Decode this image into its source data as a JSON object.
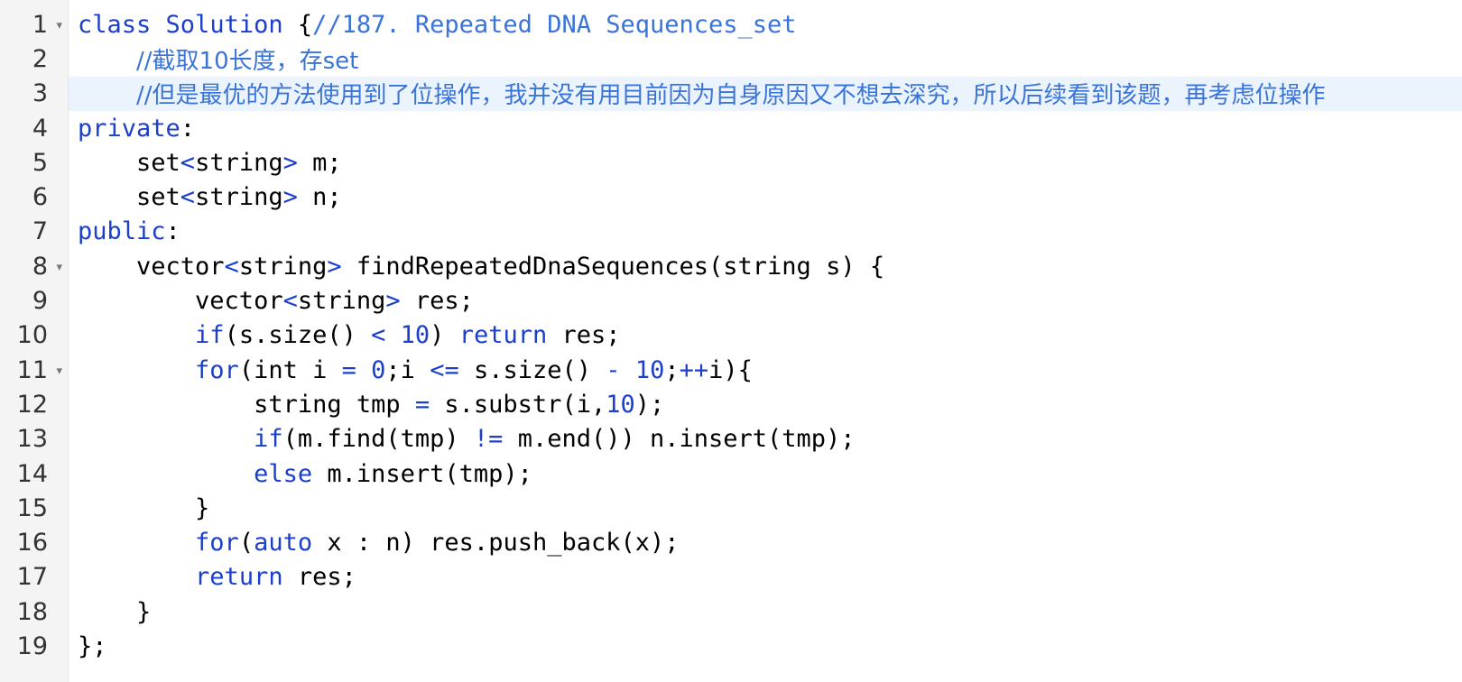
{
  "editor": {
    "active_line": 3,
    "colors": {
      "keyword": "#1b3fcc",
      "comment": "#3a74d8",
      "plain": "#000000",
      "gutter_bg": "#f4f4f4",
      "active_line_bg": "#ebf3fd"
    },
    "fold_icon": "chevron-down-icon",
    "lines": [
      {
        "number": "1",
        "fold": true,
        "tokens": [
          {
            "t": "kw",
            "v": "class"
          },
          {
            "t": "pl",
            "v": " "
          },
          {
            "t": "kw",
            "v": "Solution"
          },
          {
            "t": "pl",
            "v": " {"
          },
          {
            "t": "cm",
            "v": "//187. Repeated DNA Sequences_set"
          }
        ]
      },
      {
        "number": "2",
        "fold": false,
        "tokens": [
          {
            "t": "pl",
            "v": "    "
          },
          {
            "t": "cm",
            "v": "//截取10长度，存set"
          }
        ]
      },
      {
        "number": "3",
        "fold": false,
        "tokens": [
          {
            "t": "pl",
            "v": "    "
          },
          {
            "t": "cm",
            "v": "//但是最优的方法使用到了位操作，我并没有用目前因为自身原因又不想去深究，所以后续看到该题，再考虑位操作"
          }
        ]
      },
      {
        "number": "4",
        "fold": false,
        "tokens": [
          {
            "t": "kw",
            "v": "private"
          },
          {
            "t": "pl",
            "v": ":"
          }
        ]
      },
      {
        "number": "5",
        "fold": false,
        "tokens": [
          {
            "t": "pl",
            "v": "    set"
          },
          {
            "t": "op",
            "v": "<"
          },
          {
            "t": "pl",
            "v": "string"
          },
          {
            "t": "op",
            "v": ">"
          },
          {
            "t": "pl",
            "v": " m;"
          }
        ]
      },
      {
        "number": "6",
        "fold": false,
        "tokens": [
          {
            "t": "pl",
            "v": "    set"
          },
          {
            "t": "op",
            "v": "<"
          },
          {
            "t": "pl",
            "v": "string"
          },
          {
            "t": "op",
            "v": ">"
          },
          {
            "t": "pl",
            "v": " n;"
          }
        ]
      },
      {
        "number": "7",
        "fold": false,
        "tokens": [
          {
            "t": "kw",
            "v": "public"
          },
          {
            "t": "pl",
            "v": ":"
          }
        ]
      },
      {
        "number": "8",
        "fold": true,
        "tokens": [
          {
            "t": "pl",
            "v": "    vector"
          },
          {
            "t": "op",
            "v": "<"
          },
          {
            "t": "pl",
            "v": "string"
          },
          {
            "t": "op",
            "v": ">"
          },
          {
            "t": "pl",
            "v": " findRepeatedDnaSequences(string s) {"
          }
        ]
      },
      {
        "number": "9",
        "fold": false,
        "tokens": [
          {
            "t": "pl",
            "v": "        vector"
          },
          {
            "t": "op",
            "v": "<"
          },
          {
            "t": "pl",
            "v": "string"
          },
          {
            "t": "op",
            "v": ">"
          },
          {
            "t": "pl",
            "v": " res;"
          }
        ]
      },
      {
        "number": "10",
        "fold": false,
        "tokens": [
          {
            "t": "pl",
            "v": "        "
          },
          {
            "t": "kw",
            "v": "if"
          },
          {
            "t": "pl",
            "v": "(s.size() "
          },
          {
            "t": "op",
            "v": "<"
          },
          {
            "t": "pl",
            "v": " "
          },
          {
            "t": "num",
            "v": "10"
          },
          {
            "t": "pl",
            "v": ") "
          },
          {
            "t": "kw",
            "v": "return"
          },
          {
            "t": "pl",
            "v": " res;"
          }
        ]
      },
      {
        "number": "11",
        "fold": true,
        "tokens": [
          {
            "t": "pl",
            "v": "        "
          },
          {
            "t": "kw",
            "v": "for"
          },
          {
            "t": "pl",
            "v": "(int i "
          },
          {
            "t": "op",
            "v": "="
          },
          {
            "t": "pl",
            "v": " "
          },
          {
            "t": "num",
            "v": "0"
          },
          {
            "t": "pl",
            "v": ";i "
          },
          {
            "t": "op",
            "v": "<="
          },
          {
            "t": "pl",
            "v": " s.size() "
          },
          {
            "t": "op",
            "v": "-"
          },
          {
            "t": "pl",
            "v": " "
          },
          {
            "t": "num",
            "v": "10"
          },
          {
            "t": "pl",
            "v": ";"
          },
          {
            "t": "op",
            "v": "++"
          },
          {
            "t": "pl",
            "v": "i){"
          }
        ]
      },
      {
        "number": "12",
        "fold": false,
        "tokens": [
          {
            "t": "pl",
            "v": "            string tmp "
          },
          {
            "t": "op",
            "v": "="
          },
          {
            "t": "pl",
            "v": " s.substr(i,"
          },
          {
            "t": "num",
            "v": "10"
          },
          {
            "t": "pl",
            "v": ");"
          }
        ]
      },
      {
        "number": "13",
        "fold": false,
        "tokens": [
          {
            "t": "pl",
            "v": "            "
          },
          {
            "t": "kw",
            "v": "if"
          },
          {
            "t": "pl",
            "v": "(m.find(tmp) "
          },
          {
            "t": "op",
            "v": "!="
          },
          {
            "t": "pl",
            "v": " m.end()) n.insert(tmp);"
          }
        ]
      },
      {
        "number": "14",
        "fold": false,
        "tokens": [
          {
            "t": "pl",
            "v": "            "
          },
          {
            "t": "kw",
            "v": "else"
          },
          {
            "t": "pl",
            "v": " m.insert(tmp);"
          }
        ]
      },
      {
        "number": "15",
        "fold": false,
        "tokens": [
          {
            "t": "pl",
            "v": "        }"
          }
        ]
      },
      {
        "number": "16",
        "fold": false,
        "tokens": [
          {
            "t": "pl",
            "v": "        "
          },
          {
            "t": "kw",
            "v": "for"
          },
          {
            "t": "pl",
            "v": "("
          },
          {
            "t": "kw",
            "v": "auto"
          },
          {
            "t": "pl",
            "v": " x : n) res.push_back(x);"
          }
        ]
      },
      {
        "number": "17",
        "fold": false,
        "tokens": [
          {
            "t": "pl",
            "v": "        "
          },
          {
            "t": "kw",
            "v": "return"
          },
          {
            "t": "pl",
            "v": " res;"
          }
        ]
      },
      {
        "number": "18",
        "fold": false,
        "tokens": [
          {
            "t": "pl",
            "v": "    }"
          }
        ]
      },
      {
        "number": "19",
        "fold": false,
        "tokens": [
          {
            "t": "pl",
            "v": "};"
          }
        ]
      }
    ]
  }
}
